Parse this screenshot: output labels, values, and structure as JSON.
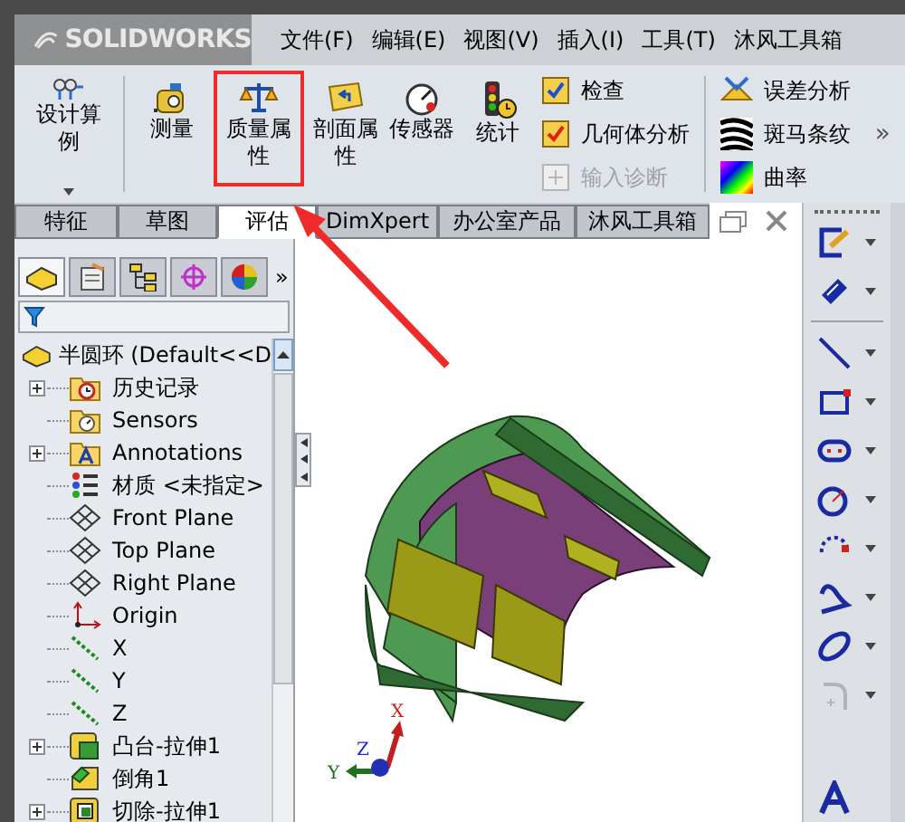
{
  "logo": "SOLIDWORKS",
  "menu": [
    "文件(F)",
    "编辑(E)",
    "视图(V)",
    "插入(I)",
    "工具(T)",
    "沐风工具箱"
  ],
  "ribbon": {
    "design_study": {
      "label": "设计算例"
    },
    "tools": [
      {
        "label": "测量",
        "kind": "measure",
        "highlighted": false
      },
      {
        "label": "质量属性",
        "kind": "mass",
        "highlighted": true
      },
      {
        "label": "剖面属性",
        "kind": "section",
        "highlighted": false
      },
      {
        "label": "传感器",
        "kind": "sensor",
        "highlighted": false
      },
      {
        "label": "统计",
        "kind": "stats",
        "highlighted": false
      }
    ],
    "checks": [
      {
        "label": "检查",
        "disabled": false
      },
      {
        "label": "几何体分析",
        "disabled": false
      },
      {
        "label": "输入诊断",
        "disabled": true
      }
    ],
    "analysis": [
      {
        "label": "误差分析",
        "kind": "deviation"
      },
      {
        "label": "斑马条纹",
        "kind": "zebra"
      },
      {
        "label": "曲率",
        "kind": "curvature"
      }
    ],
    "more": "»"
  },
  "tabs": [
    {
      "label": "特征",
      "selected": false
    },
    {
      "label": "草图",
      "selected": false
    },
    {
      "label": "评估",
      "selected": true
    },
    {
      "label": "DimXpert",
      "selected": false
    },
    {
      "label": "办公室产品",
      "selected": false
    },
    {
      "label": "沐风工具箱",
      "selected": false
    }
  ],
  "panel_more": "»",
  "tree": {
    "root": "半圆环  (Default<<D",
    "items": [
      {
        "label": "历史记录",
        "kind": "history",
        "expandable": true
      },
      {
        "label": "Sensors",
        "kind": "sensor",
        "expandable": false
      },
      {
        "label": "Annotations",
        "kind": "annotation",
        "expandable": true
      },
      {
        "label": "材质 <未指定>",
        "kind": "material",
        "expandable": false
      },
      {
        "label": "Front Plane",
        "kind": "plane",
        "expandable": false
      },
      {
        "label": "Top Plane",
        "kind": "plane",
        "expandable": false
      },
      {
        "label": "Right Plane",
        "kind": "plane",
        "expandable": false
      },
      {
        "label": "Origin",
        "kind": "origin",
        "expandable": false
      },
      {
        "label": "X",
        "kind": "axis",
        "expandable": false
      },
      {
        "label": "Y",
        "kind": "axis",
        "expandable": false
      },
      {
        "label": "Z",
        "kind": "axis",
        "expandable": false
      },
      {
        "label": "凸台-拉伸1",
        "kind": "boss",
        "expandable": true
      },
      {
        "label": "倒角1",
        "kind": "chamfer",
        "expandable": false
      },
      {
        "label": "切除-拉伸1",
        "kind": "cut",
        "expandable": true
      }
    ]
  },
  "triad": {
    "x": "X",
    "y": "Y",
    "z": "Z"
  }
}
